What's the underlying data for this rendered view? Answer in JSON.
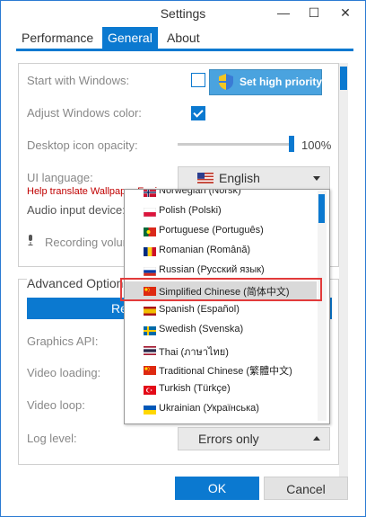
{
  "window": {
    "title": "Settings"
  },
  "tabs": [
    {
      "label": "Performance"
    },
    {
      "label": "General"
    },
    {
      "label": "About"
    }
  ],
  "general": {
    "start_with_windows": "Start with Windows:",
    "set_high_priority": "Set high priority",
    "adjust_windows_color": "Adjust Windows color:",
    "desktop_icon_opacity": "Desktop icon opacity:",
    "opacity_value": "100%",
    "opacity_level": 1.0,
    "ui_language": "UI language:",
    "ui_language_value": "English",
    "help_translate": "Help translate Wallpaper Engine",
    "audio_input_device": "Audio input device:",
    "recording_volume": "Recording volume"
  },
  "advanced": {
    "title": "Advanced Options",
    "button_label": "Reset",
    "graphics_api": "Graphics API:",
    "video_loading": "Video loading:",
    "video_loop": "Video loop:",
    "log_level": "Log level:",
    "log_level_value": "Errors only"
  },
  "language_dropdown": {
    "items": [
      {
        "label": "Norwegian (Norsk)"
      },
      {
        "label": "Polish (Polski)"
      },
      {
        "label": "Portuguese (Português)"
      },
      {
        "label": "Romanian (Română)"
      },
      {
        "label": "Russian (Русский язык)"
      },
      {
        "label": "Simplified Chinese (简体中文)"
      },
      {
        "label": "Spanish (Español)"
      },
      {
        "label": "Swedish (Svenska)"
      },
      {
        "label": "Thai (ภาษาไทย)"
      },
      {
        "label": "Traditional Chinese (繁體中文)"
      },
      {
        "label": "Turkish (Türkçe)"
      },
      {
        "label": "Ukrainian (Українська)"
      }
    ],
    "selected": "Simplified Chinese (简体中文)"
  },
  "buttons": {
    "ok": "OK",
    "cancel": "Cancel"
  },
  "colors": {
    "accent": "#0b79d0",
    "highlight_border": "#e23b3b",
    "help_text": "#c00000"
  }
}
